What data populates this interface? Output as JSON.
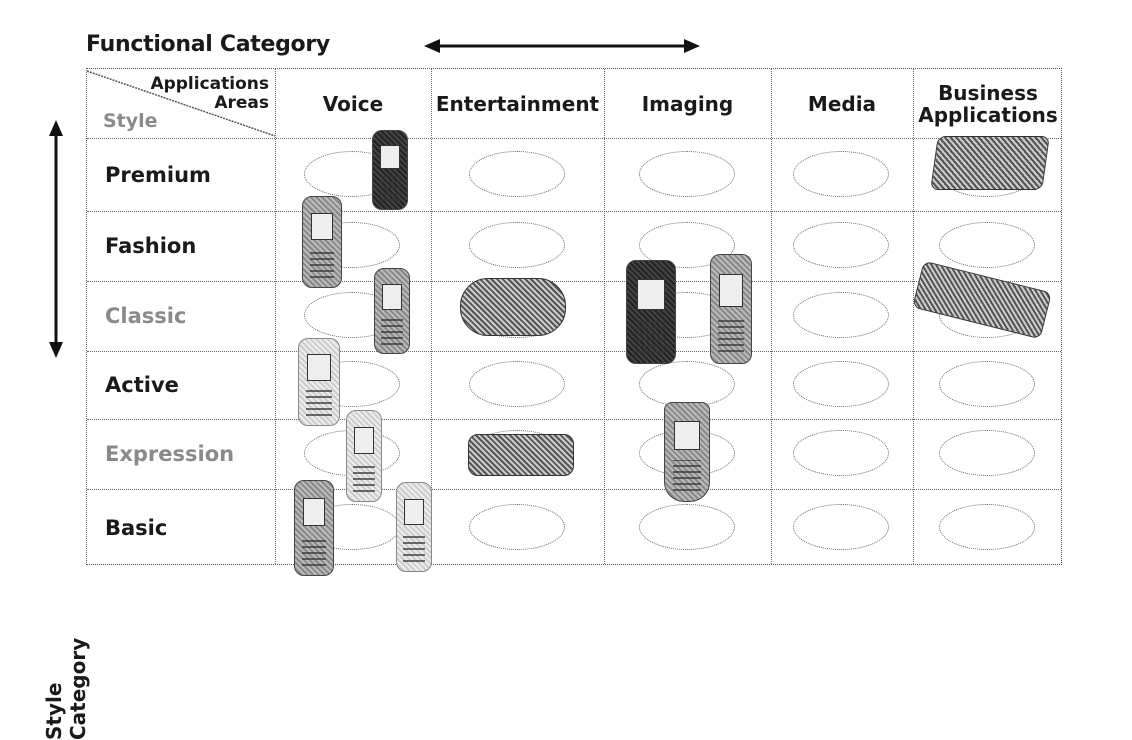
{
  "axes": {
    "functional_category": "Functional Category",
    "style_category": "Style Category"
  },
  "corner": {
    "top_label_line1": "Applications",
    "top_label_line2": "Areas",
    "bottom_label": "Style"
  },
  "columns": [
    {
      "label_line1": "Voice",
      "label_line2": ""
    },
    {
      "label_line1": "Entertainment",
      "label_line2": ""
    },
    {
      "label_line1": "Imaging",
      "label_line2": ""
    },
    {
      "label_line1": "Media",
      "label_line2": ""
    },
    {
      "label_line1": "Business",
      "label_line2": "Applications"
    }
  ],
  "rows": [
    {
      "label": "Premium"
    },
    {
      "label": "Fashion"
    },
    {
      "label": "Classic"
    },
    {
      "label": "Active"
    },
    {
      "label": "Expression"
    },
    {
      "label": "Basic"
    }
  ],
  "icons": {
    "horizontal_arrow": "double-arrow-horizontal",
    "vertical_arrow": "double-arrow-vertical"
  }
}
